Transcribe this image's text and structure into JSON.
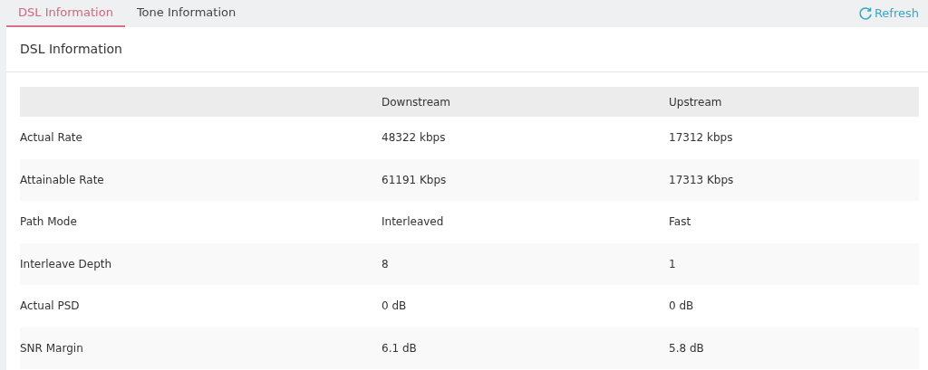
{
  "tabs": [
    {
      "label": "DSL Information",
      "selected": true
    },
    {
      "label": "Tone Information",
      "selected": false
    }
  ],
  "refresh_button": {
    "label": "Refresh"
  },
  "panel": {
    "title": "DSL Information"
  },
  "table": {
    "columns": [
      "Downstream",
      "Upstream"
    ],
    "rows": [
      {
        "label": "Actual Rate",
        "downstream": "48322 kbps",
        "upstream": "17312 kbps"
      },
      {
        "label": "Attainable Rate",
        "downstream": "61191 Kbps",
        "upstream": "17313 Kbps"
      },
      {
        "label": "Path Mode",
        "downstream": "Interleaved",
        "upstream": "Fast"
      },
      {
        "label": "Interleave Depth",
        "downstream": "8",
        "upstream": "1"
      },
      {
        "label": "Actual PSD",
        "downstream": "0 dB",
        "upstream": "0 dB"
      },
      {
        "label": "SNR Margin",
        "downstream": "6.1 dB",
        "upstream": "5.8 dB"
      }
    ]
  }
}
